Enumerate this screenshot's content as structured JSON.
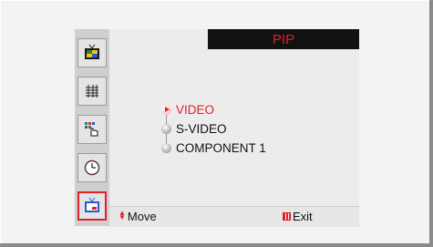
{
  "menu": {
    "title": "PIP",
    "options": [
      {
        "label": "VIDEO",
        "selected": true
      },
      {
        "label": "S-VIDEO",
        "selected": false
      },
      {
        "label": "COMPONENT 1",
        "selected": false
      }
    ]
  },
  "sidebar": {
    "items": [
      {
        "icon": "picture-icon"
      },
      {
        "icon": "sound-icon"
      },
      {
        "icon": "channel-icon"
      },
      {
        "icon": "setup-icon"
      },
      {
        "icon": "input-icon",
        "selected": true
      }
    ]
  },
  "footer": {
    "move_label": "Move",
    "exit_label": "Exit"
  },
  "colors": {
    "accent": "#e0202a",
    "title_bg": "#111111"
  }
}
